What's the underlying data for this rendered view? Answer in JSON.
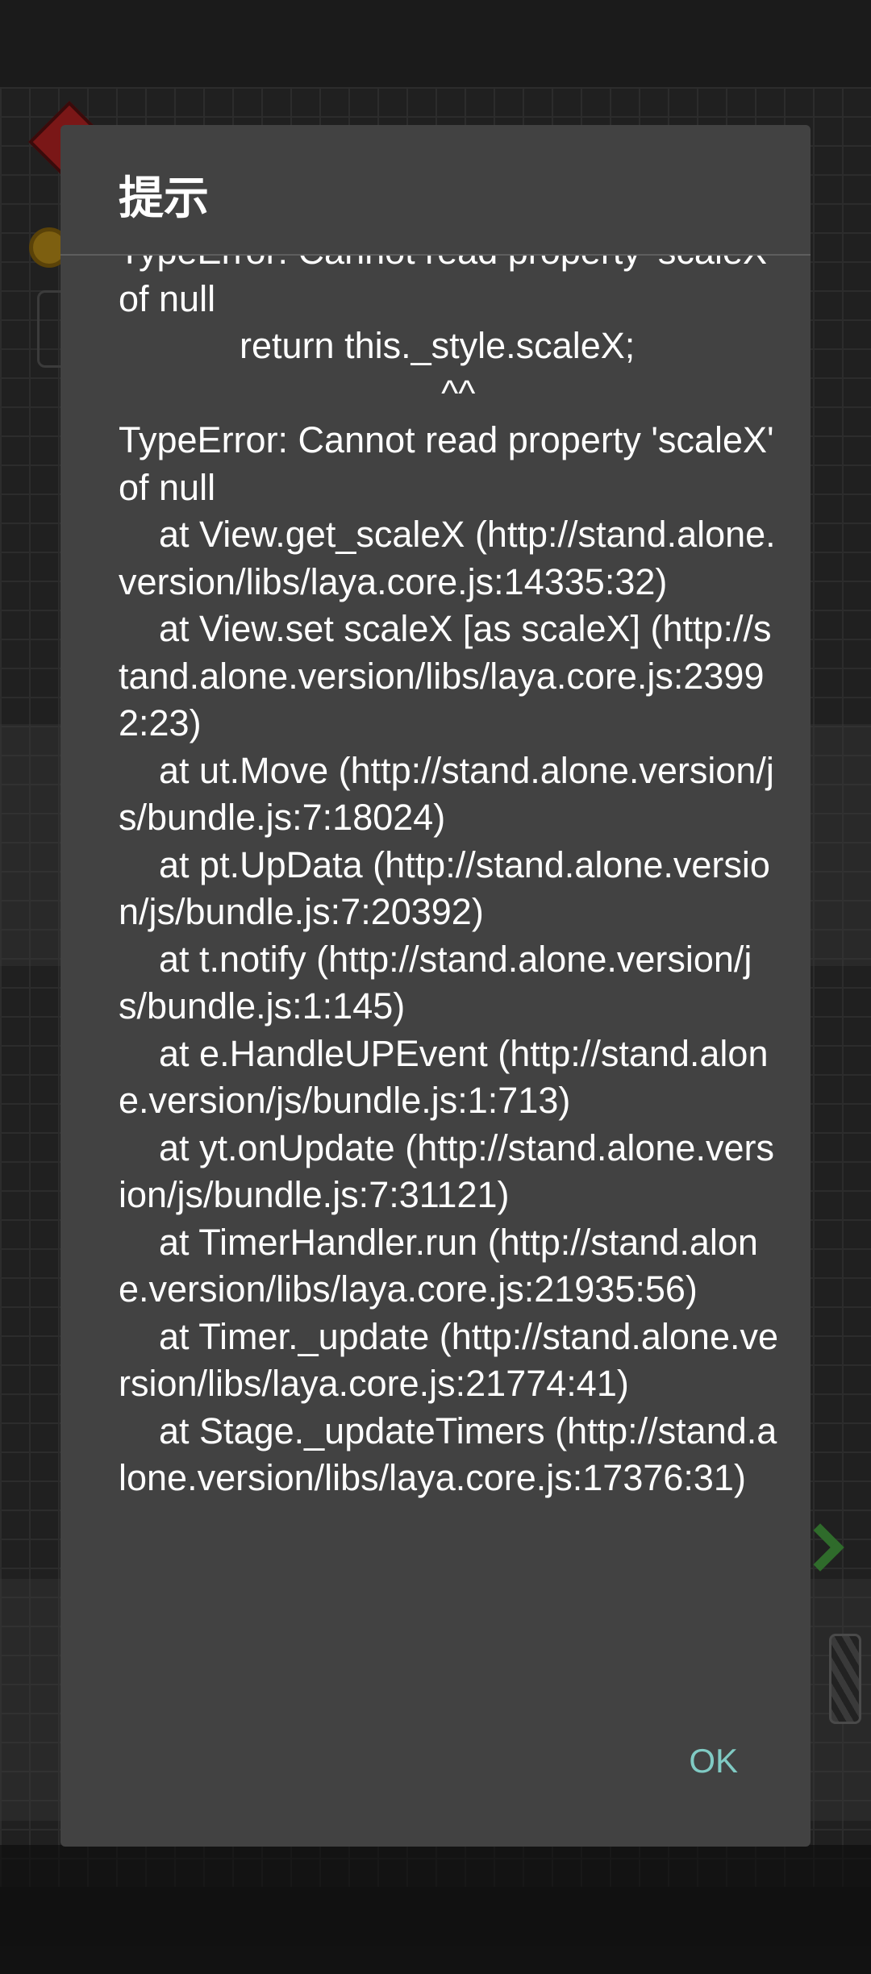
{
  "dialog": {
    "title": "提示",
    "message": "TypeError: Cannot read property 'scaleX' of null\n            return this._style.scaleX;\n                                ^^\nTypeError: Cannot read property 'scaleX' of null\n    at View.get_scaleX (http://stand.alone.version/libs/laya.core.js:14335:32)\n    at View.set scaleX [as scaleX] (http://stand.alone.version/libs/laya.core.js:23992:23)\n    at ut.Move (http://stand.alone.version/js/bundle.js:7:18024)\n    at pt.UpData (http://stand.alone.version/js/bundle.js:7:20392)\n    at t.notify (http://stand.alone.version/js/bundle.js:1:145)\n    at e.HandleUPEvent (http://stand.alone.version/js/bundle.js:1:713)\n    at yt.onUpdate (http://stand.alone.version/js/bundle.js:7:31121)\n    at TimerHandler.run (http://stand.alone.version/libs/laya.core.js:21935:56)\n    at Timer._update (http://stand.alone.version/libs/laya.core.js:21774:41)\n    at Stage._updateTimers (http://stand.alone.version/libs/laya.core.js:17376:31)",
    "ok_label": "OK"
  },
  "colors": {
    "dialog_background": "#424242",
    "text": "#ffffff",
    "accent": "#80cbc4",
    "backdrop": "#1b1b1b"
  }
}
